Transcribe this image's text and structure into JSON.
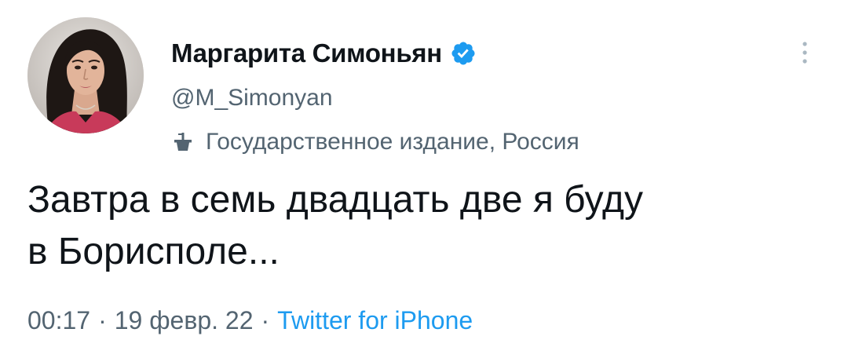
{
  "author": {
    "display_name": "Маргарита Симоньян",
    "handle": "@M_Simonyan",
    "label": "Государственное издание, Россия",
    "verified": true
  },
  "tweet": {
    "text_line1": "Завтра в семь двадцать две я буду",
    "text_line2": "в Борисполе..."
  },
  "meta": {
    "time": "00:17",
    "separator": "·",
    "date": "19 февр. 22",
    "source": "Twitter for iPhone"
  },
  "icons": {
    "verified": "verified-badge-icon",
    "label": "government-podium-icon",
    "more": "more-vertical-icon"
  },
  "colors": {
    "verified": "#1d9bf0",
    "secondary_text": "#536471",
    "link": "#1d9bf0",
    "primary_text": "#0f1419"
  }
}
